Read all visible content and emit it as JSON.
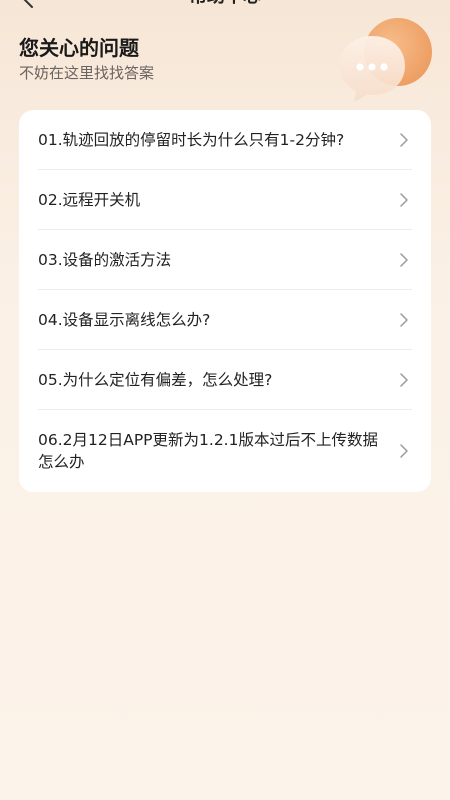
{
  "nav": {
    "title": "帮助中心"
  },
  "header": {
    "title": "您关心的问题",
    "subtitle": "不妨在这里找找答案"
  },
  "faq": {
    "items": [
      {
        "label": "01.轨迹回放的停留时长为什么只有1-2分钟?"
      },
      {
        "label": "02.远程开关机"
      },
      {
        "label": "03.设备的激活方法"
      },
      {
        "label": "04.设备显示离线怎么办?"
      },
      {
        "label": "05.为什么定位有偏差，怎么处理?"
      },
      {
        "label": "06.2月12日APP更新为1.2.1版本过后不上传数据怎么办"
      }
    ]
  },
  "colors": {
    "accent_orange": "#f0a86a",
    "background": "#fbf1e6",
    "card": "#ffffff"
  },
  "icons": [
    "back-arrow-icon",
    "chat-bubble-icon",
    "chevron-right-icon"
  ]
}
